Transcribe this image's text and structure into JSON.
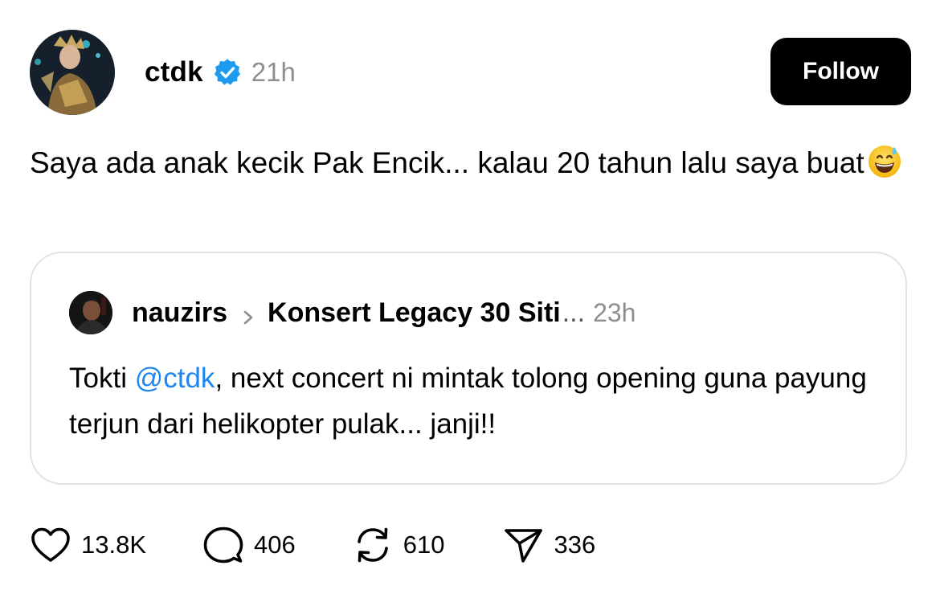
{
  "post": {
    "username": "ctdk",
    "timestamp": "21h",
    "follow_label": "Follow",
    "text": "Saya ada anak kecik Pak Encik... kalau 20 tahun lalu saya buat",
    "emoji": "grinning-face-with-sweat"
  },
  "quote": {
    "username": "nauzirs",
    "thread_title": "Konsert Legacy 30 Siti",
    "ellipsis": "...",
    "timestamp": "23h",
    "text_before": "Tokti ",
    "mention": "@ctdk",
    "text_after": ", next concert ni mintak tolong opening guna payung terjun dari helikopter pulak... janji!!"
  },
  "actions": {
    "likes": "13.8K",
    "replies": "406",
    "reposts": "610",
    "shares": "336"
  },
  "colors": {
    "verified": "#1d9bf0",
    "mention": "#1d87f0",
    "muted": "#8e8e8e",
    "follow_bg": "#000000"
  },
  "icons": [
    "verified-badge-icon",
    "chevron-right-icon",
    "heart-icon",
    "comment-icon",
    "repost-icon",
    "send-icon"
  ]
}
